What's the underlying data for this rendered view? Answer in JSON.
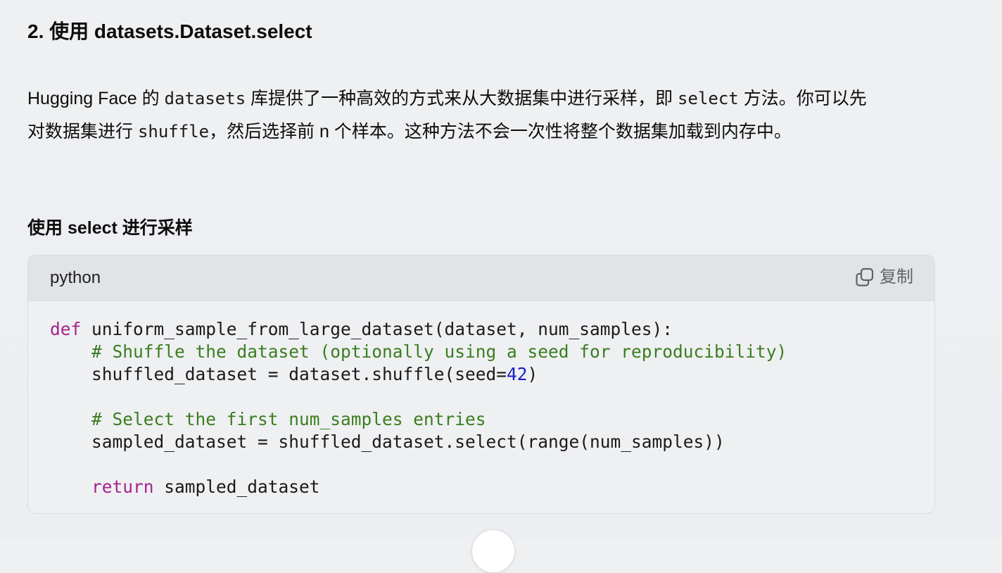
{
  "section": {
    "heading": "2. 使用 datasets.Dataset.select"
  },
  "paragraph": {
    "part1": "Hugging Face 的 ",
    "code1": "datasets",
    "part2": " 库提供了一种高效的方式来从大数据集中进行采样，即 ",
    "code2": "select",
    "part3": " 方法。你可以先对数据集进行 ",
    "code3": "shuffle",
    "part4": "，然后选择前 n 个样本。这种方法不会一次性将整个数据集加载到内存中。"
  },
  "subheading": "使用 select 进行采样",
  "code_block": {
    "language": "python",
    "copy_label": "复制",
    "copy_icon": "copy-icon",
    "lines": {
      "l1_kw": "def",
      "l1_rest": " uniform_sample_from_large_dataset(dataset, num_samples):",
      "l2_indent": "    ",
      "l2_comment": "# Shuffle the dataset (optionally using a seed for reproducibility)",
      "l3_pre": "    shuffled_dataset = dataset.shuffle(seed=",
      "l3_num": "42",
      "l3_post": ")",
      "l5_indent": "    ",
      "l5_comment": "# Select the first num_samples entries",
      "l6": "    sampled_dataset = shuffled_dataset.select(range(num_samples))",
      "l8_indent": "    ",
      "l8_kw": "return",
      "l8_rest": " sampled_dataset"
    },
    "colors": {
      "keyword": "#a5228f",
      "comment": "#3a7d1f",
      "number": "#1922c8"
    }
  }
}
